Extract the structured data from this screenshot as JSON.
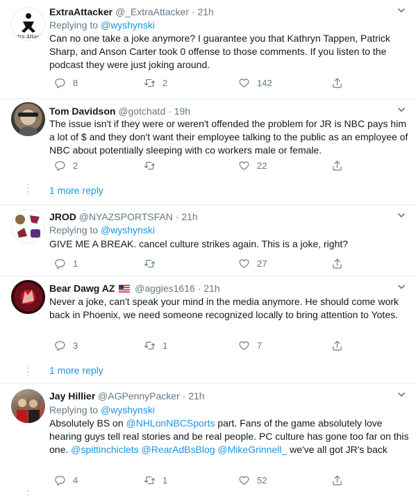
{
  "tweets": [
    {
      "name": "ExtraAttacker",
      "handle": "@_ExtraAttacker",
      "dot": "·",
      "time": "21h",
      "avatar_text": "xtra Attack",
      "replying_prefix": "Replying to",
      "replying_to": "@wyshynski",
      "text": "Can no one take a joke anymore? I guarantee you that Kathryn Tappen, Patrick Sharp, and Anson Carter took 0 offense to those comments. If you listen to the podcast they were just joking around.",
      "reply_count": "8",
      "retweet_count": "2",
      "like_count": "142"
    },
    {
      "name": "Tom Davidson",
      "handle": "@gotchatd",
      "dot": "·",
      "time": "19h",
      "text": "The issue isn't if they were or weren't offended the problem for JR is NBC pays him a lot of $ and they don't want their employee talking to the public as an employee of NBC about potentially sleeping with co workers male or female.",
      "reply_count": "2",
      "retweet_count": "",
      "like_count": "22",
      "more_reply": "1 more reply"
    },
    {
      "name": "JROD",
      "handle": "@NYAZSPORTSFAN",
      "dot": "·",
      "time": "21h",
      "replying_prefix": "Replying to",
      "replying_to": "@wyshynski",
      "text": "GIVE ME A BREAK.  cancel culture strikes again. This is a joke, right?",
      "reply_count": "1",
      "retweet_count": "",
      "like_count": "27"
    },
    {
      "name": "Bear Dawg AZ",
      "handle": "@aggies1616",
      "dot": "·",
      "time": "21h",
      "text": "Never a joke, can't speak your mind in the media anymore. He should come work back in Phoenix, we need someone recognized locally to bring attention to Yotes.",
      "reply_count": "3",
      "retweet_count": "1",
      "like_count": "7",
      "more_reply": "1 more reply"
    },
    {
      "name": "Jay Hillier",
      "handle": "@AGPennyPacker",
      "dot": "·",
      "time": "21h",
      "replying_prefix": "Replying to",
      "replying_to": "@wyshynski",
      "text_parts": [
        "Absolutely BS on ",
        "@NHLonNBCSports",
        " part. Fans of the game absolutely love hearing guys tell real stories and be real people. PC culture has gone too far on this one. ",
        "@spittinchiclets",
        " ",
        "@RearAdBsBlog",
        " ",
        "@MikeGrinnell_",
        " we've all got JR's back"
      ],
      "reply_count": "4",
      "retweet_count": "1",
      "like_count": "52"
    }
  ],
  "colors": {
    "text": "#14171a",
    "secondary": "#657786",
    "link": "#1b95e0",
    "border": "#e6ecf0"
  },
  "icons": [
    "reply-icon",
    "retweet-icon",
    "like-icon",
    "share-icon",
    "caret-down-icon",
    "us-flag-icon"
  ]
}
